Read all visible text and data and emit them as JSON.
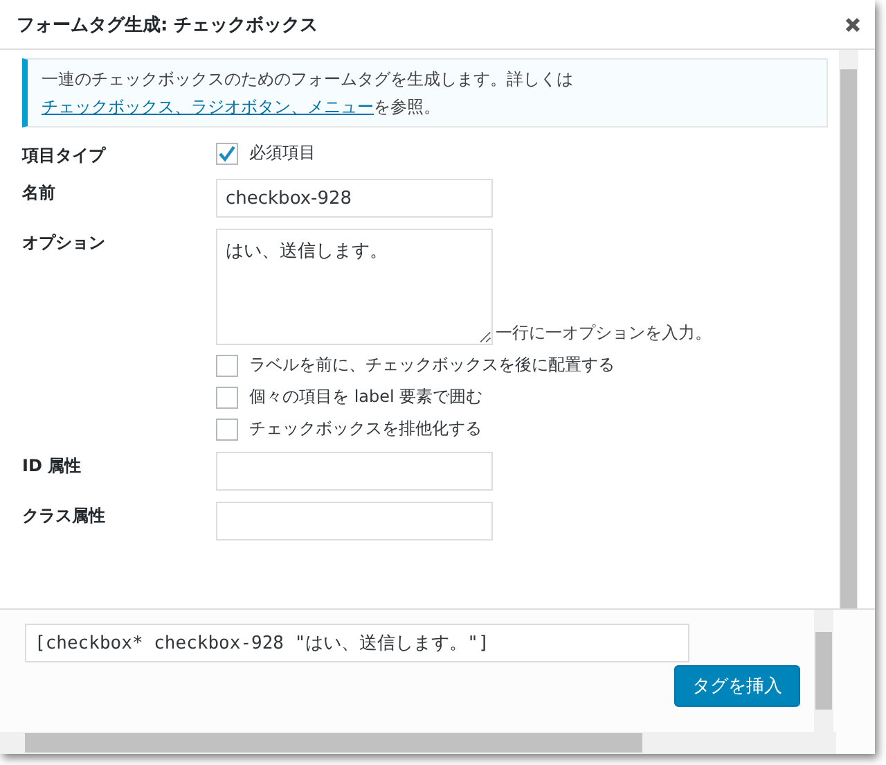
{
  "dialog": {
    "title": "フォームタグ生成: チェックボックス"
  },
  "notice": {
    "text": "一連のチェックボックスのためのフォームタグを生成します。詳しくは",
    "link": "チェックボックス、ラジオボタン、メニュー",
    "text_after": "を参照。"
  },
  "fields": [
    {
      "kind": "checkbox",
      "label": "項目タイプ",
      "option": "必須項目",
      "checked": true
    },
    {
      "kind": "text",
      "label": "名前",
      "value": "checkbox-928"
    },
    {
      "kind": "textarea",
      "label": "オプション",
      "value": "はい、送信します。",
      "hint": "一行に一オプションを入力。",
      "options": [
        {
          "label": "ラベルを前に、チェックボックスを後に配置する",
          "checked": false
        },
        {
          "label": "個々の項目を label 要素で囲む",
          "checked": false
        },
        {
          "label": "チェックボックスを排他化する",
          "checked": false
        }
      ]
    },
    {
      "kind": "text",
      "label": "ID 属性"
    },
    {
      "kind": "text",
      "label": "クラス属性"
    }
  ],
  "tag_output": {
    "value": "[checkbox* checkbox-928 \"はい、送信します。\"]",
    "insert_button": "タグを挿入"
  }
}
